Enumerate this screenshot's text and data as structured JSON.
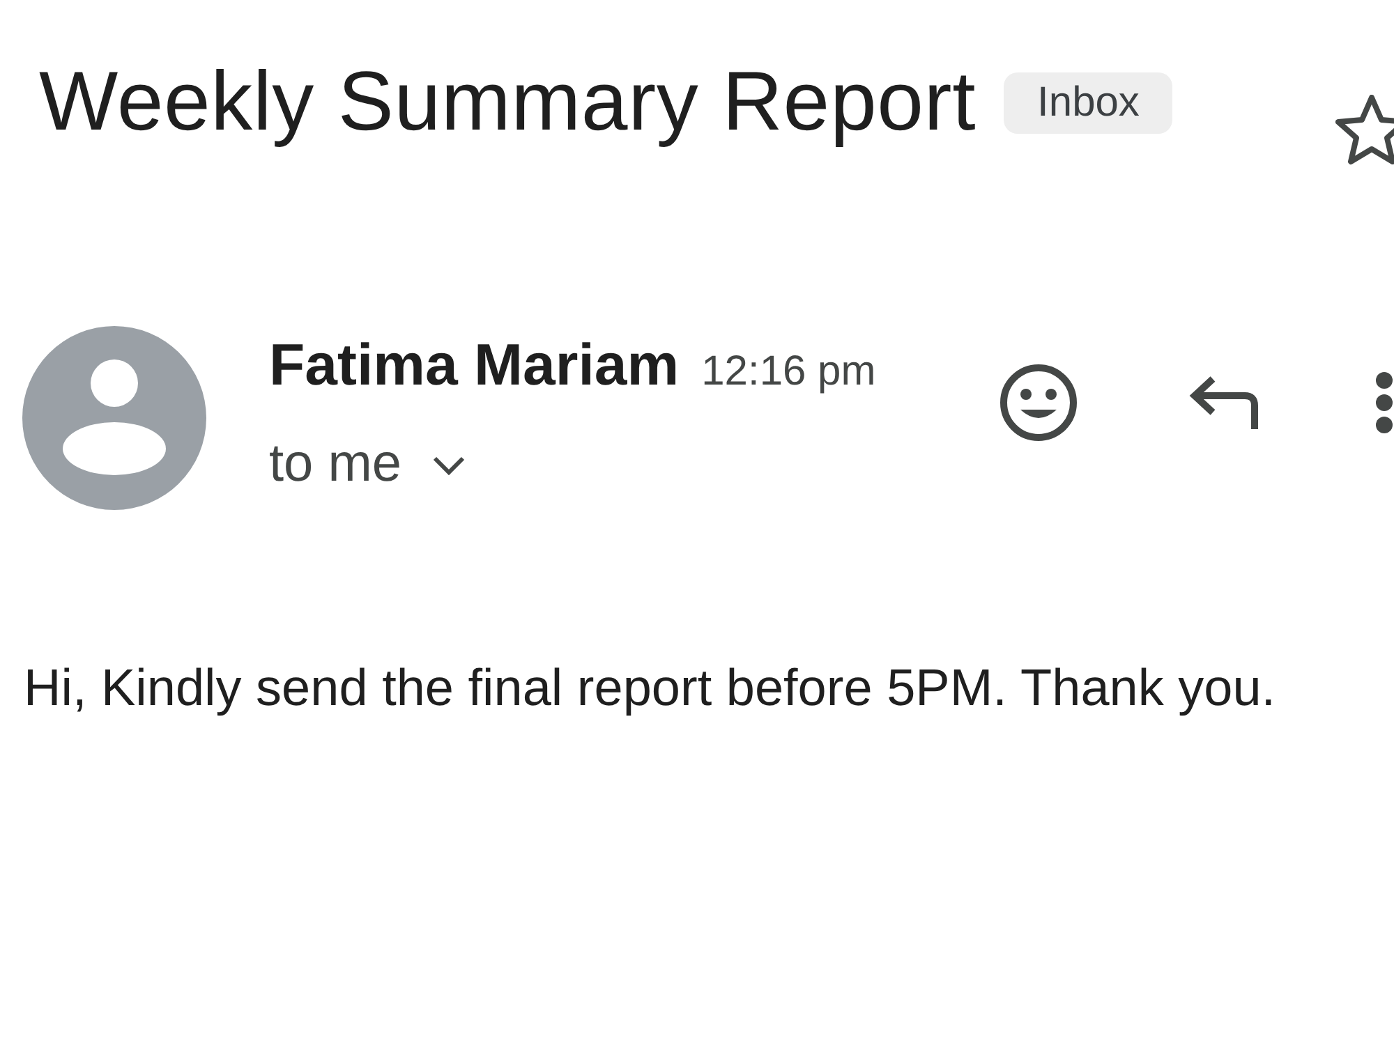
{
  "subject": {
    "title": "Weekly Summary Report",
    "label": "Inbox",
    "starred": false
  },
  "message": {
    "sender": "Fatima Mariam",
    "time": "12:16 pm",
    "recipient": "to me",
    "recipient_details_expanded": false,
    "body": "Hi, Kindly send the final report before 5PM. Thank you."
  }
}
